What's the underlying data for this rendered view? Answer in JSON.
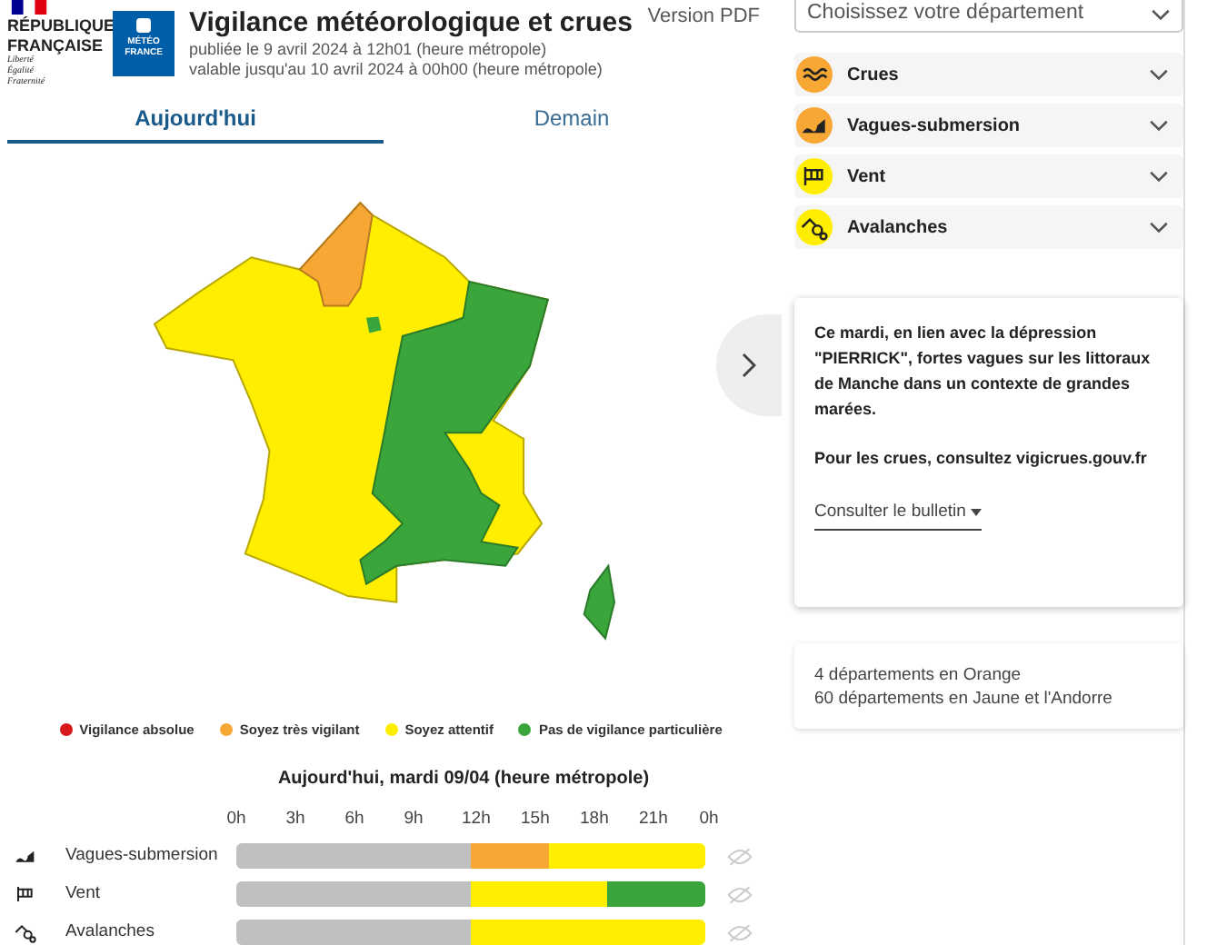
{
  "header": {
    "republic_lines": [
      "RÉPUBLIQUE",
      "FRANÇAISE"
    ],
    "motto": [
      "Liberté",
      "Égalité",
      "Fraternité"
    ],
    "brand_lines": [
      "MÉTÉO",
      "FRANCE"
    ],
    "title": "Vigilance météorologique et crues",
    "published": "publiée le 9 avril 2024 à 12h01 (heure métropole)",
    "valid": "valable jusqu'au 10 avril 2024 à 00h00 (heure métropole)",
    "pdf_link": "Version PDF"
  },
  "tabs": [
    {
      "label": "Aujourd'hui",
      "selected": true
    },
    {
      "label": "Demain",
      "selected": false
    }
  ],
  "legend": [
    {
      "label": "Vigilance absolue",
      "color": "#d7191c"
    },
    {
      "label": "Soyez très vigilant",
      "color": "#f7a733"
    },
    {
      "label": "Soyez attentif",
      "color": "#ffee00"
    },
    {
      "label": "Pas de vigilance particulière",
      "color": "#3aa53a"
    }
  ],
  "timeline": {
    "title": "Aujourd'hui, mardi 09/04 (heure métropole)",
    "hours": [
      "0h",
      "3h",
      "6h",
      "9h",
      "12h",
      "15h",
      "18h",
      "21h",
      "0h"
    ],
    "rows": [
      {
        "kind": "waves",
        "label": "Vagues-submersion",
        "hourly": [
          {
            "color": "#c0c0c0"
          },
          {
            "color": "#c0c0c0"
          },
          {
            "color": "#c0c0c0"
          },
          {
            "color": "#c0c0c0"
          },
          {
            "color": "#c0c0c0"
          },
          {
            "color": "#c0c0c0"
          },
          {
            "color": "#c0c0c0"
          },
          {
            "color": "#c0c0c0"
          },
          {
            "color": "#c0c0c0"
          },
          {
            "color": "#c0c0c0"
          },
          {
            "color": "#c0c0c0"
          },
          {
            "color": "#c0c0c0"
          },
          {
            "color": "#f7a733"
          },
          {
            "color": "#f7a733"
          },
          {
            "color": "#f7a733"
          },
          {
            "color": "#f7a733"
          },
          {
            "color": "#ffee00"
          },
          {
            "color": "#ffee00"
          },
          {
            "color": "#ffee00"
          },
          {
            "color": "#ffee00"
          },
          {
            "color": "#ffee00"
          },
          {
            "color": "#ffee00"
          },
          {
            "color": "#ffee00"
          },
          {
            "color": "#ffee00"
          }
        ]
      },
      {
        "kind": "wind",
        "label": "Vent",
        "hourly": [
          {
            "color": "#c0c0c0"
          },
          {
            "color": "#c0c0c0"
          },
          {
            "color": "#c0c0c0"
          },
          {
            "color": "#c0c0c0"
          },
          {
            "color": "#c0c0c0"
          },
          {
            "color": "#c0c0c0"
          },
          {
            "color": "#c0c0c0"
          },
          {
            "color": "#c0c0c0"
          },
          {
            "color": "#c0c0c0"
          },
          {
            "color": "#c0c0c0"
          },
          {
            "color": "#c0c0c0"
          },
          {
            "color": "#c0c0c0"
          },
          {
            "color": "#ffee00"
          },
          {
            "color": "#ffee00"
          },
          {
            "color": "#ffee00"
          },
          {
            "color": "#ffee00"
          },
          {
            "color": "#ffee00"
          },
          {
            "color": "#ffee00"
          },
          {
            "color": "#ffee00"
          },
          {
            "color": "#3aa53a"
          },
          {
            "color": "#3aa53a"
          },
          {
            "color": "#3aa53a"
          },
          {
            "color": "#3aa53a"
          },
          {
            "color": "#3aa53a"
          }
        ]
      },
      {
        "kind": "avalanche",
        "label": "Avalanches",
        "hourly": [
          {
            "color": "#c0c0c0"
          },
          {
            "color": "#c0c0c0"
          },
          {
            "color": "#c0c0c0"
          },
          {
            "color": "#c0c0c0"
          },
          {
            "color": "#c0c0c0"
          },
          {
            "color": "#c0c0c0"
          },
          {
            "color": "#c0c0c0"
          },
          {
            "color": "#c0c0c0"
          },
          {
            "color": "#c0c0c0"
          },
          {
            "color": "#c0c0c0"
          },
          {
            "color": "#c0c0c0"
          },
          {
            "color": "#c0c0c0"
          },
          {
            "color": "#ffee00"
          },
          {
            "color": "#ffee00"
          },
          {
            "color": "#ffee00"
          },
          {
            "color": "#ffee00"
          },
          {
            "color": "#ffee00"
          },
          {
            "color": "#ffee00"
          },
          {
            "color": "#ffee00"
          },
          {
            "color": "#ffee00"
          },
          {
            "color": "#ffee00"
          },
          {
            "color": "#ffee00"
          },
          {
            "color": "#ffee00"
          },
          {
            "color": "#ffee00"
          }
        ]
      }
    ]
  },
  "department_select": {
    "placeholder": "Choisissez votre département"
  },
  "hazards": [
    {
      "kind": "flood",
      "label": "Crues",
      "color": "#f7a733",
      "expanded": false
    },
    {
      "kind": "waves",
      "label": "Vagues-submersion",
      "color": "#f7a733",
      "expanded": false
    },
    {
      "kind": "wind",
      "label": "Vent",
      "color": "#ffee00",
      "expanded": false
    },
    {
      "kind": "avalanche",
      "label": "Avalanches",
      "color": "#ffee00",
      "expanded": false
    }
  ],
  "bulletin_card": {
    "paragraphs": [
      "Ce mardi, en lien avec la dépression \"PIERRICK\", fortes vagues sur les littoraux de Manche dans un contexte de grandes marées.",
      "Pour les crues, consultez vigicrues.gouv.fr"
    ],
    "link": "Consulter le bulletin"
  },
  "summary_card": {
    "lines": [
      "4 départements en Orange",
      "60 départements en Jaune et l'Andorre"
    ]
  }
}
